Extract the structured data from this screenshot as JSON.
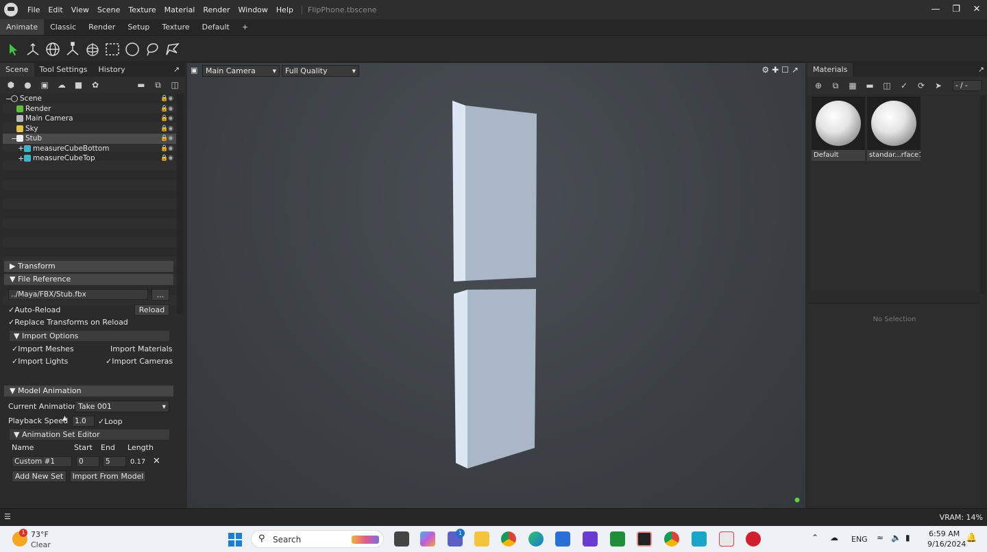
{
  "app": {
    "title": "FlipPhone.tbscene",
    "menu": [
      "File",
      "Edit",
      "View",
      "Scene",
      "Texture",
      "Material",
      "Render",
      "Window",
      "Help"
    ],
    "window_controls": [
      "minimize-icon",
      "restore-icon",
      "close-icon"
    ]
  },
  "workspace_tabs": [
    "Animate",
    "Classic",
    "Render",
    "Setup",
    "Texture",
    "Default",
    "+"
  ],
  "tools": [
    "select-arrow-icon",
    "move-tool-icon",
    "rotate-tool-icon",
    "scale-tool-icon",
    "pivot-tool-icon",
    "marquee-select-icon",
    "circle-select-icon",
    "lasso-select-icon",
    "paint-select-icon"
  ],
  "left_panel": {
    "tabs": [
      "Scene",
      "Tool Settings",
      "History"
    ],
    "tree": [
      {
        "label": "Scene",
        "indent": 0
      },
      {
        "label": "Render",
        "indent": 1
      },
      {
        "label": "Main Camera",
        "indent": 1
      },
      {
        "label": "Sky",
        "indent": 1
      },
      {
        "label": "Stub",
        "indent": 1,
        "selected": true
      },
      {
        "label": "measureCubeBottom",
        "indent": 2
      },
      {
        "label": "measureCubeTop",
        "indent": 2
      }
    ]
  },
  "transform": {
    "title": "Transform"
  },
  "file_reference": {
    "title": "File Reference",
    "path": "../Maya/FBX/Stub.fbx",
    "browse": "...",
    "auto_reload": "Auto-Reload",
    "reload": "Reload",
    "replace_transforms": "Replace Transforms on Reload",
    "import_options": "Import Options",
    "import_meshes": "Import Meshes",
    "import_materials": "Import Materials",
    "import_lights": "Import Lights",
    "import_cameras": "Import Cameras"
  },
  "model_animation": {
    "title": "Model Animation",
    "current_animation_label": "Current Animation:",
    "current_animation": "Take 001",
    "playback_speed_label": "Playback Speed",
    "playback_speed": "1.0",
    "loop": "Loop",
    "set_editor": "Animation Set Editor",
    "col_name": "Name",
    "col_start": "Start",
    "col_end": "End",
    "col_length": "Length",
    "row": {
      "name": "Custom #1",
      "start": "0",
      "end": "5",
      "length": "0.17"
    },
    "add_new_set": "Add New Set",
    "import_from_model": "Import From Model"
  },
  "viewport": {
    "camera": "Main Camera",
    "quality": "Full Quality"
  },
  "materials": {
    "tab": "Materials",
    "page": "- / -",
    "items": [
      "Default",
      "standar...rface1"
    ],
    "no_selection": "No Selection"
  },
  "status": {
    "vram": "VRAM: 14%"
  },
  "taskbar": {
    "temp": "73°F",
    "weather": "Clear",
    "search": "Search",
    "lang": "ENG",
    "time": "6:59 AM",
    "date": "9/16/2024",
    "teams_badge": "1",
    "weather_badge": "1"
  }
}
